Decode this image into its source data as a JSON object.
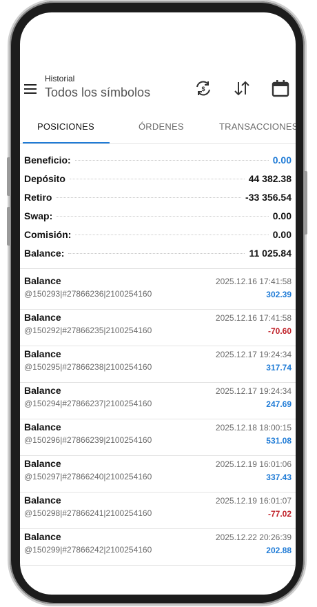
{
  "header": {
    "small_title": "Historial",
    "big_title": "Todos los símbolos",
    "icons": [
      "sync-icon",
      "sort-icon",
      "calendar-icon"
    ]
  },
  "tabs": [
    {
      "label": "POSICIONES",
      "active": true
    },
    {
      "label": "ÓRDENES",
      "active": false
    },
    {
      "label": "TRANSACCIONES",
      "active": false
    }
  ],
  "summary": [
    {
      "label": "Beneficio:",
      "value": "0.00",
      "color": "#1f7bd6"
    },
    {
      "label": "Depósito",
      "value": "44 382.38",
      "color": "#111111"
    },
    {
      "label": "Retiro",
      "value": "-33 356.54",
      "color": "#111111"
    },
    {
      "label": "Swap:",
      "value": "0.00",
      "color": "#111111"
    },
    {
      "label": "Comisión:",
      "value": "0.00",
      "color": "#111111"
    },
    {
      "label": "Balance:",
      "value": "11 025.84",
      "color": "#111111"
    }
  ],
  "items": [
    {
      "title": "Balance",
      "sub": "@150293|#27866236|2100254160",
      "date": "2025.12.16 17:41:58",
      "amount": "302.39",
      "sign": "pos"
    },
    {
      "title": "Balance",
      "sub": "@150292|#27866235|2100254160",
      "date": "2025.12.16 17:41:58",
      "amount": "-70.60",
      "sign": "neg"
    },
    {
      "title": "Balance",
      "sub": "@150295|#27866238|2100254160",
      "date": "2025.12.17 19:24:34",
      "amount": "317.74",
      "sign": "pos"
    },
    {
      "title": "Balance",
      "sub": "@150294|#27866237|2100254160",
      "date": "2025.12.17 19:24:34",
      "amount": "247.69",
      "sign": "pos"
    },
    {
      "title": "Balance",
      "sub": "@150296|#27866239|2100254160",
      "date": "2025.12.18 18:00:15",
      "amount": "531.08",
      "sign": "pos"
    },
    {
      "title": "Balance",
      "sub": "@150297|#27866240|2100254160",
      "date": "2025.12.19 16:01:06",
      "amount": "337.43",
      "sign": "pos"
    },
    {
      "title": "Balance",
      "sub": "@150298|#27866241|2100254160",
      "date": "2025.12.19 16:01:07",
      "amount": "-77.02",
      "sign": "neg"
    },
    {
      "title": "Balance",
      "sub": "@150299|#27866242|2100254160",
      "date": "2025.12.22 20:26:39",
      "amount": "202.88",
      "sign": "pos"
    }
  ],
  "colors": {
    "accent": "#1f7bd6",
    "negative": "#c0222a"
  }
}
